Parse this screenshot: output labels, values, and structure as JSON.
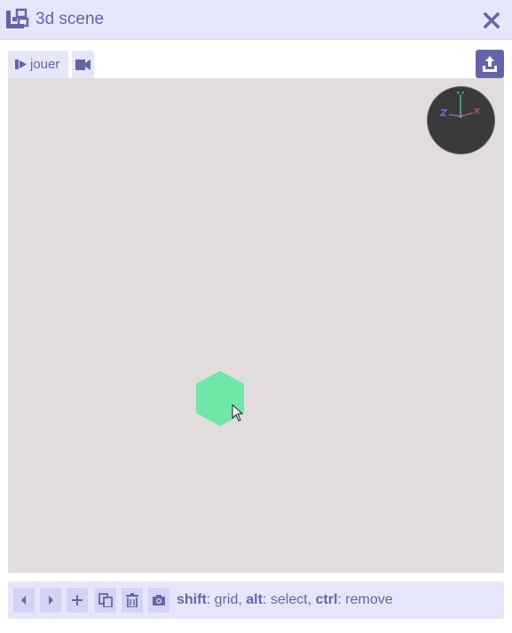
{
  "window": {
    "title": "3d scene",
    "icon": "scene-icon",
    "close_icon": "close-icon"
  },
  "tabs": [
    {
      "label": "jouer",
      "icon": "play-icon"
    },
    {
      "label": "",
      "icon": "camera-icon"
    }
  ],
  "toolbar": {
    "export_icon": "export-icon"
  },
  "viewport": {
    "background": "#e1dddd",
    "object_color": "#6ee8a6",
    "gizmo": {
      "axes": [
        "x",
        "y",
        "z"
      ],
      "axis_colors": {
        "x": "#a65a5a",
        "y": "#54b59a",
        "z": "#6e6ee0"
      }
    }
  },
  "bottom_bar": {
    "buttons": [
      {
        "icon": "previous-icon"
      },
      {
        "icon": "next-icon"
      },
      {
        "icon": "plus-icon"
      },
      {
        "icon": "copy-icon"
      },
      {
        "icon": "trash-icon"
      },
      {
        "icon": "camera-snapshot-icon"
      }
    ],
    "hints": [
      {
        "key": "shift",
        "action": ": grid, "
      },
      {
        "key": "alt",
        "action": ": select, "
      },
      {
        "key": "ctrl",
        "action": ": remove"
      }
    ]
  },
  "colors": {
    "accent": "#6465a8",
    "bar_bg": "#e6e6fb",
    "button_bg": "#d3d3f6"
  }
}
